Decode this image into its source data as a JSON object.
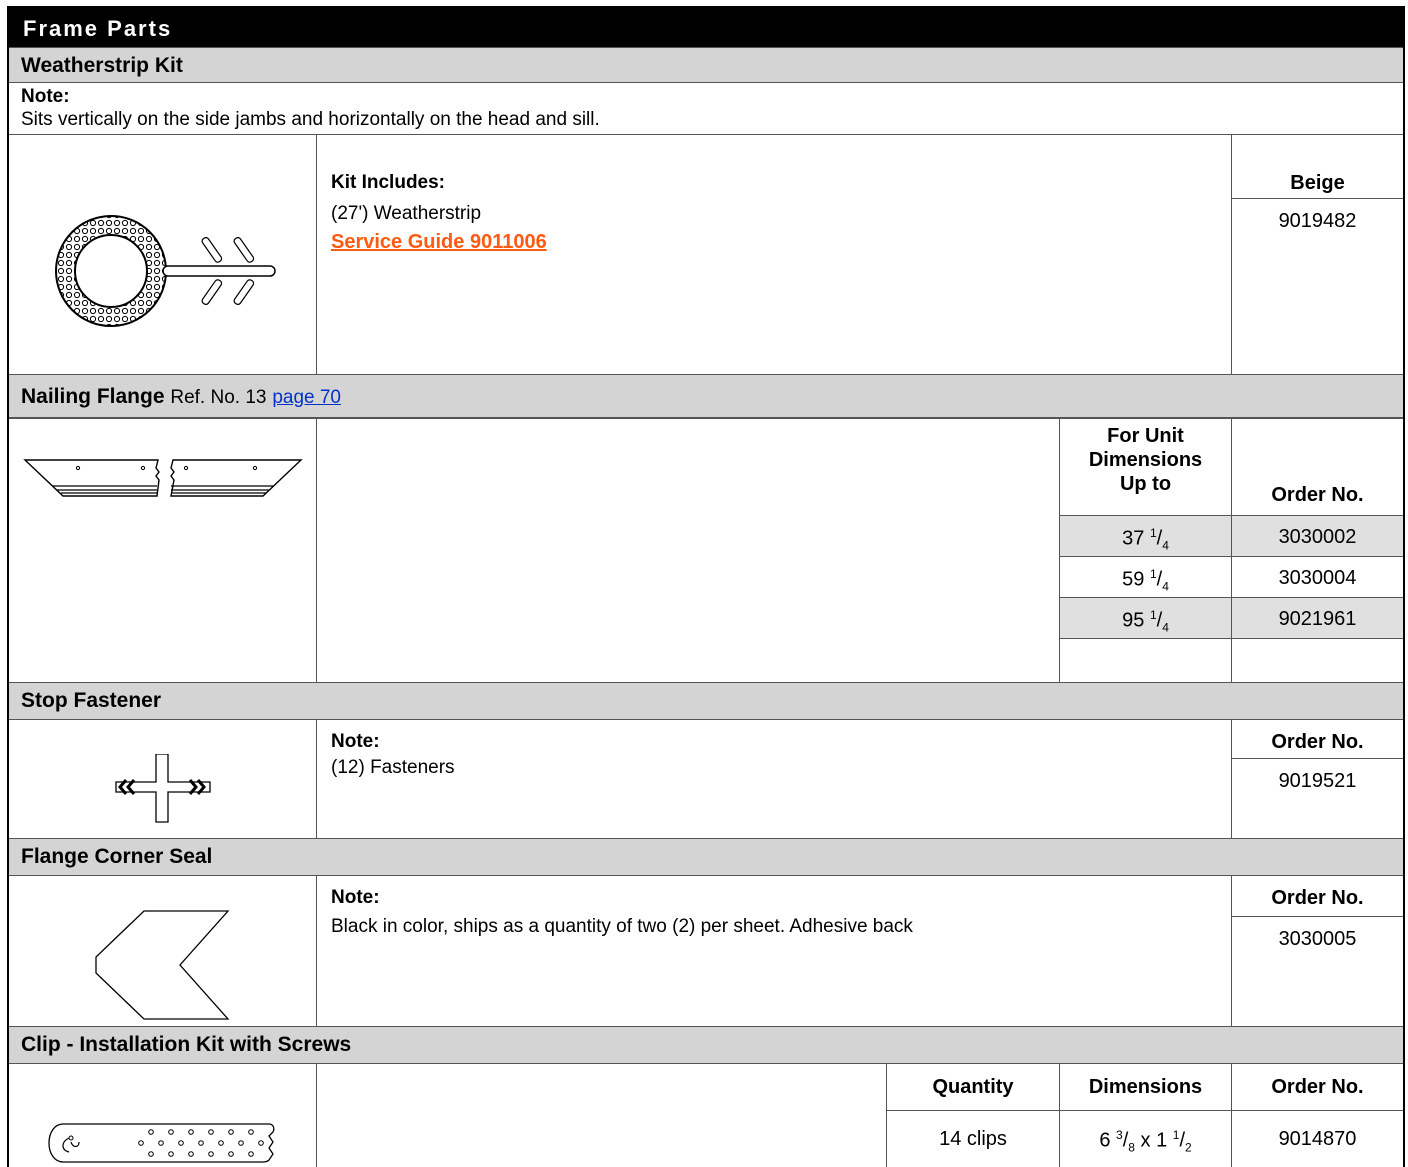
{
  "header": {
    "title": "Frame Parts"
  },
  "weatherstrip": {
    "section_title": "Weatherstrip Kit",
    "note_label": "Note:",
    "note_text": "Sits vertically on the side jambs and horizontally on the head and sill.",
    "includes_label": "Kit Includes:",
    "includes_item": "(27') Weatherstrip",
    "service_link": "Service Guide 9011006",
    "color_header": "Beige",
    "order_no": "9019482"
  },
  "nailing_flange": {
    "section_title": "Nailing Flange",
    "ref_text": "Ref. No. 13",
    "page_link": "page 70",
    "col_unit_line1": "For Unit",
    "col_unit_line2": "Dimensions",
    "col_unit_line3": "Up to",
    "col_order": "Order No.",
    "rows": [
      {
        "whole": "37",
        "num": "1",
        "den": "4",
        "order": "3030002"
      },
      {
        "whole": "59",
        "num": "1",
        "den": "4",
        "order": "3030004"
      },
      {
        "whole": "95",
        "num": "1",
        "den": "4",
        "order": "9021961"
      }
    ]
  },
  "stop_fastener": {
    "section_title": "Stop Fastener",
    "note_label": "Note:",
    "note_text": "(12) Fasteners",
    "col_order": "Order No.",
    "order_no": "9019521"
  },
  "corner_seal": {
    "section_title": "Flange Corner Seal",
    "note_label": "Note:",
    "note_text": "Black in color, ships as a quantity of two (2) per sheet. Adhesive back",
    "col_order": "Order No.",
    "order_no": "3030005"
  },
  "clip_kit": {
    "section_title": "Clip - Installation Kit with Screws",
    "col_qty": "Quantity",
    "col_dim": "Dimensions",
    "col_order": "Order No.",
    "qty": "14 clips",
    "dim_w_whole": "6",
    "dim_w_num": "3",
    "dim_w_den": "8",
    "dim_x": "x",
    "dim_h_whole": "1",
    "dim_h_num": "1",
    "dim_h_den": "2",
    "order_no": "9014870"
  }
}
